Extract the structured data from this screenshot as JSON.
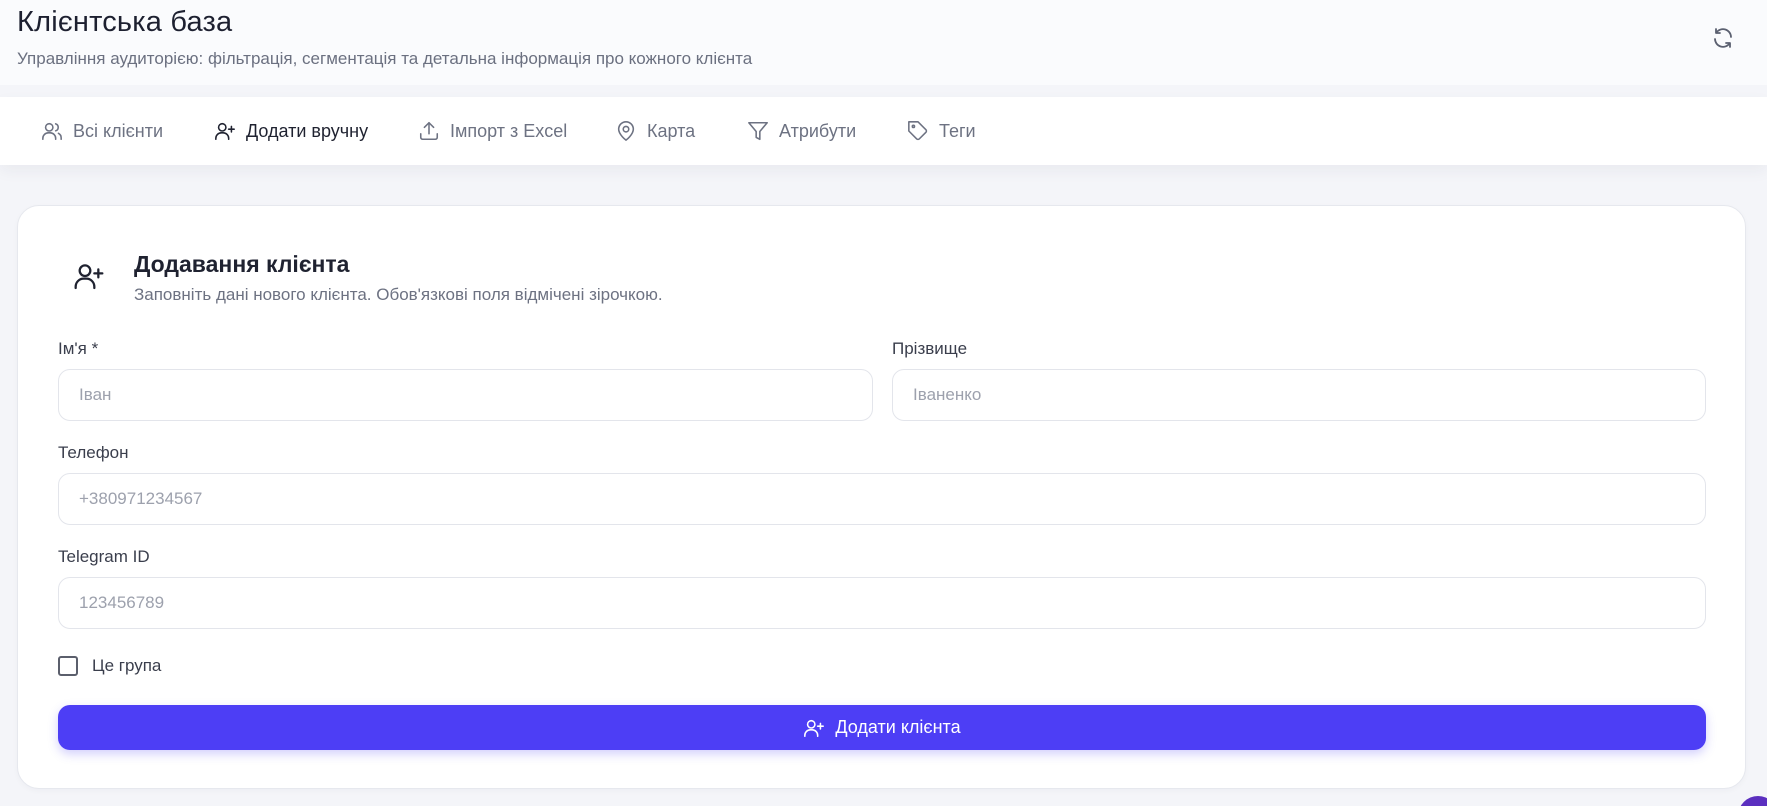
{
  "header": {
    "title": "Клієнтська база",
    "subtitle": "Управління аудиторією: фільтрація, сегментація та детальна інформація про кожного клієнта",
    "refresh_icon": "refresh-icon"
  },
  "tabs": [
    {
      "label": "Всі клієнти",
      "icon": "users-icon",
      "active": false
    },
    {
      "label": "Додати вручну",
      "icon": "user-plus-icon",
      "active": true
    },
    {
      "label": "Імпорт з Excel",
      "icon": "upload-icon",
      "active": false
    },
    {
      "label": "Карта",
      "icon": "map-pin-icon",
      "active": false
    },
    {
      "label": "Атрибути",
      "icon": "filter-icon",
      "active": false
    },
    {
      "label": "Теги",
      "icon": "tag-icon",
      "active": false
    }
  ],
  "form": {
    "title": "Додавання клієнта",
    "description": "Заповніть дані нового клієнта. Обов'язкові поля відмічені зірочкою.",
    "first_name": {
      "label": "Ім'я *",
      "placeholder": "Іван",
      "value": ""
    },
    "last_name": {
      "label": "Прізвище",
      "placeholder": "Іваненко",
      "value": ""
    },
    "phone": {
      "label": "Телефон",
      "placeholder": "+380971234567",
      "value": ""
    },
    "telegram": {
      "label": "Telegram ID",
      "placeholder": "123456789",
      "value": ""
    },
    "is_group": {
      "label": "Це група",
      "checked": false
    },
    "submit_label": "Додати клієнта"
  },
  "colors": {
    "accent": "#4d3ef5",
    "background": "#f4f5f9"
  }
}
